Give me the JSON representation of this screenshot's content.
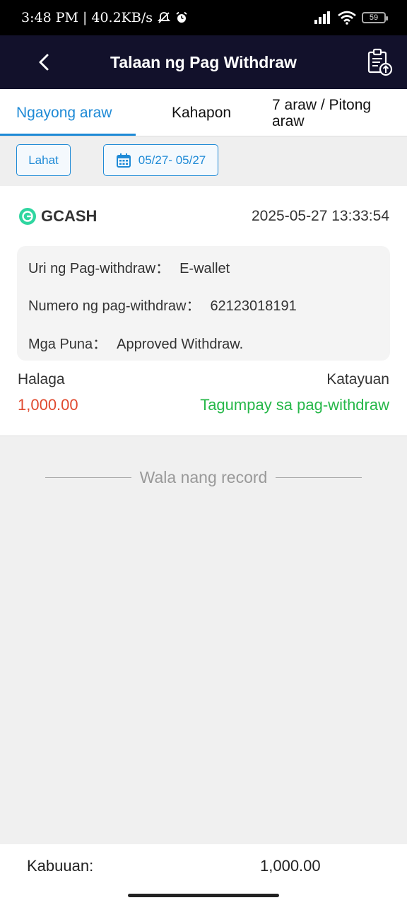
{
  "status_bar": {
    "time": "3:48 PM",
    "separator": "|",
    "speed": "40.2KB/s",
    "battery": "59",
    "icons": [
      "mute-icon",
      "alarm-icon",
      "signal-icon",
      "wifi-icon",
      "battery-icon"
    ]
  },
  "header": {
    "title": "Talaan ng Pag Withdraw",
    "icons": [
      "back-arrow-icon",
      "clipboard-upload-icon"
    ]
  },
  "tabs": [
    {
      "label": "Ngayong araw"
    },
    {
      "label": "Kahapon"
    },
    {
      "label": "7 araw / Pitong araw"
    }
  ],
  "filters": {
    "all_label": "Lahat",
    "date_range": "05/27- 05/27"
  },
  "record": {
    "provider": "GCASH",
    "datetime": "2025-05-27 13:33:54",
    "type_label": "Uri ng Pag-withdraw：",
    "type_value": "E-wallet",
    "number_label": "Numero ng pag-withdraw：",
    "number_value": "62123018191",
    "remarks_label": "Mga Puna：",
    "remarks_value": "Approved Withdraw.",
    "amount_label": "Halaga",
    "amount_value": "1,000.00",
    "status_label": "Katayuan",
    "status_value": "Tagumpay sa pag-withdraw"
  },
  "no_more": "Wala nang record",
  "footer": {
    "total_label": "Kabuuan:",
    "total_value": "1,000.00"
  },
  "colors": {
    "accent": "#1e8ad6",
    "header_bg": "#12112b",
    "amount": "#e04a2f",
    "success": "#27b84a",
    "gcash": "#2fd6a0"
  }
}
